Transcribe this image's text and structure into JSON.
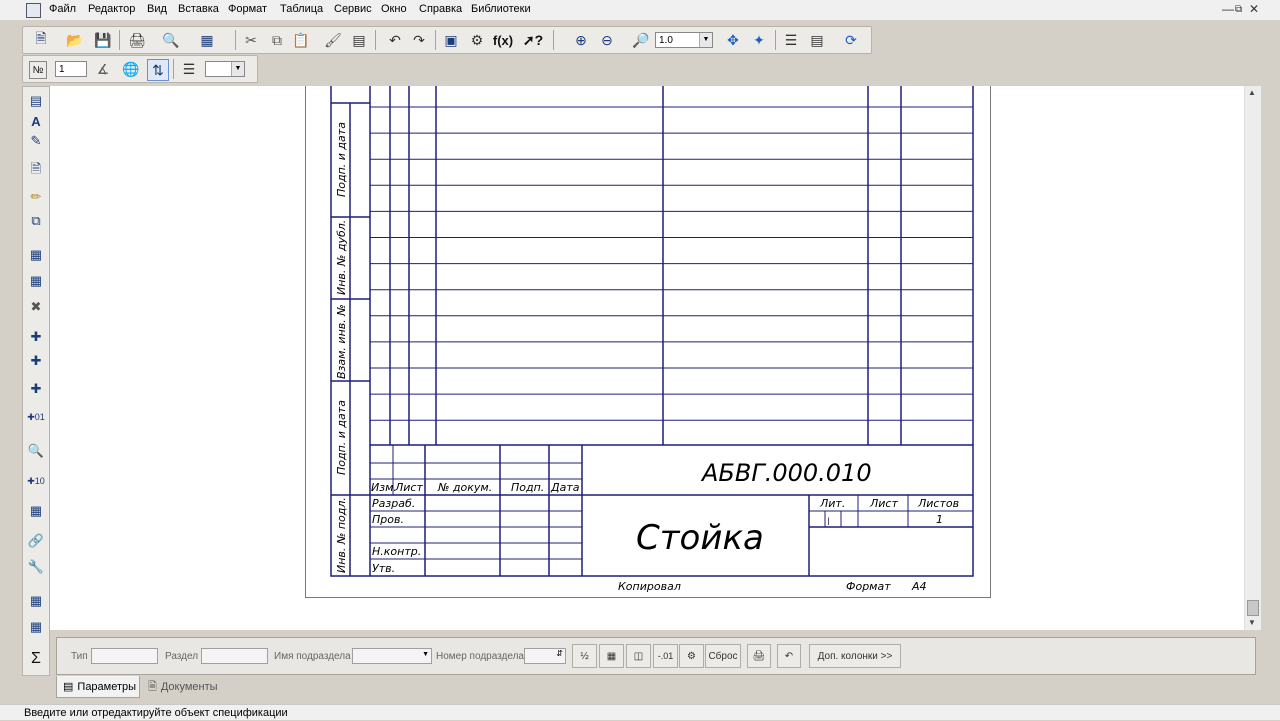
{
  "menu": {
    "items": [
      "Файл",
      "Редактор",
      "Вид",
      "Вставка",
      "Формат",
      "Таблица",
      "Сервис",
      "Окно",
      "Справка",
      "Библиотеки"
    ]
  },
  "toolbar": {
    "zoom_value": "1.0",
    "fx_label": "f(x)",
    "number_icon_label": "№",
    "position_value": "1"
  },
  "drawing": {
    "side_labels": [
      "Подп. и дата",
      "Инв. № дубл.",
      "Взам. инв. №",
      "Подп. и дата",
      "Инв. № подл."
    ],
    "title_headers": [
      "Изм.",
      "Лист",
      "№ докум.",
      "Подп.",
      "Дата"
    ],
    "row_labels": [
      "Разраб.",
      "Пров.",
      "Н.контр.",
      "Утв."
    ],
    "designation": "АБВГ.000.010",
    "part_name": "Стойка",
    "lit_header": "Лит.",
    "sheet_header": "Лист",
    "sheets_header": "Листов",
    "sheets_value": "1",
    "copied_label": "Копировал",
    "format_label": "Формат",
    "format_value": "А4"
  },
  "params_panel": {
    "type_label": "Тип",
    "section_label": "Раздел",
    "subsection_name_label": "Имя подраздела",
    "subsection_number_label": "Номер подраздела",
    "reset_button": "Сброс",
    "extra_columns_button": "Доп. колонки  >>"
  },
  "tabs": {
    "parameters": "Параметры",
    "documents": "Документы"
  },
  "status": {
    "message": "Введите или отредактируйте объект спецификации"
  },
  "colors": {
    "frame_line": "#1f1f7a",
    "canvas": "#ffffff",
    "chrome": "#d4d0c8"
  }
}
